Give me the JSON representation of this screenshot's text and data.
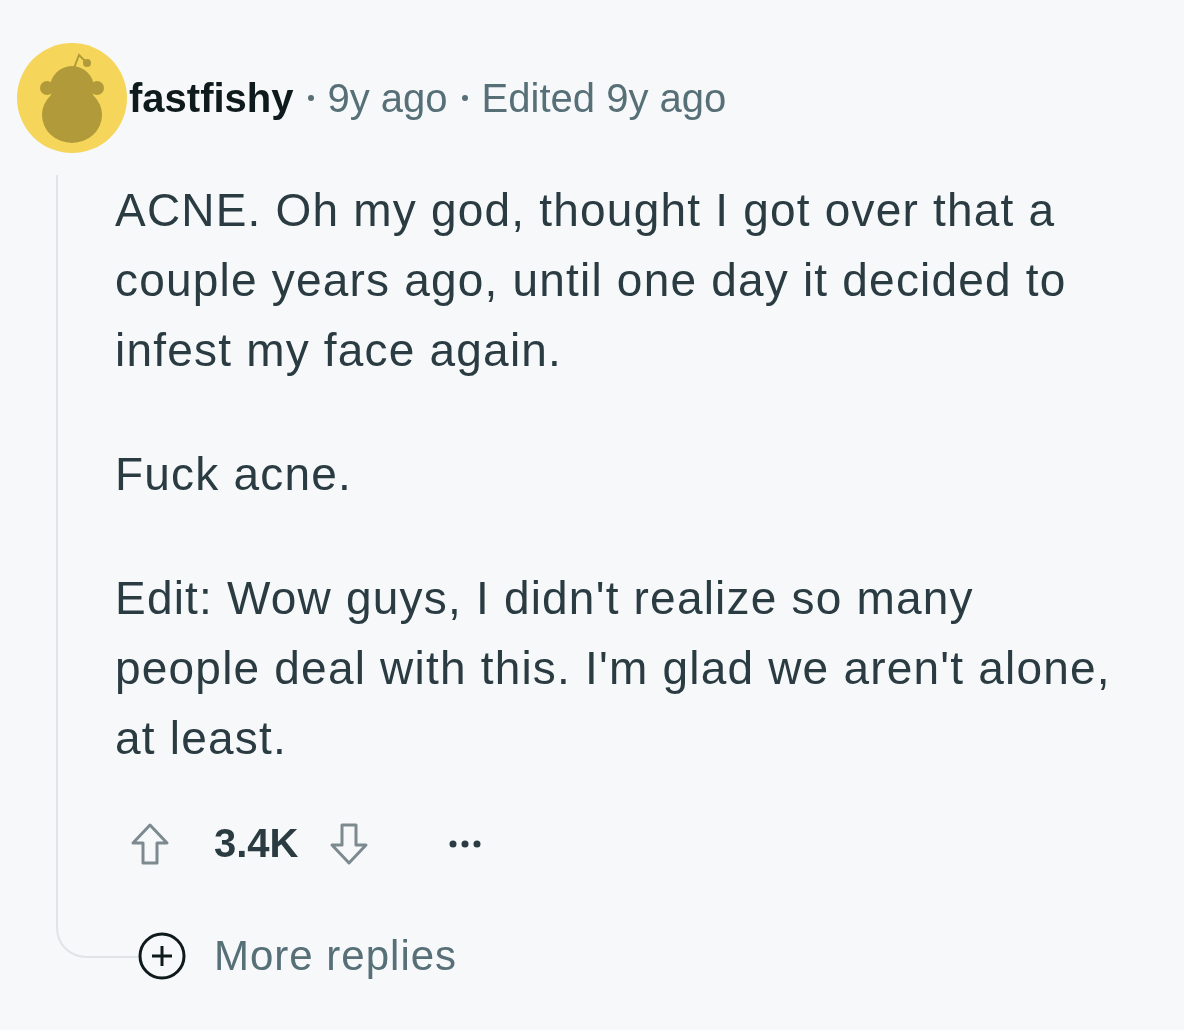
{
  "comment": {
    "author": "fastfishy",
    "time": "9y ago",
    "edited": "Edited 9y ago",
    "paragraphs": [
      "ACNE. Oh my god, thought I got over that a couple years ago, until one day it decided to infest my face again.",
      "Fuck acne.",
      "Edit: Wow guys, I didn't realize so many people deal with this. I'm glad we aren't alone, at least."
    ],
    "score": "3.4K",
    "more_replies": "More replies"
  }
}
